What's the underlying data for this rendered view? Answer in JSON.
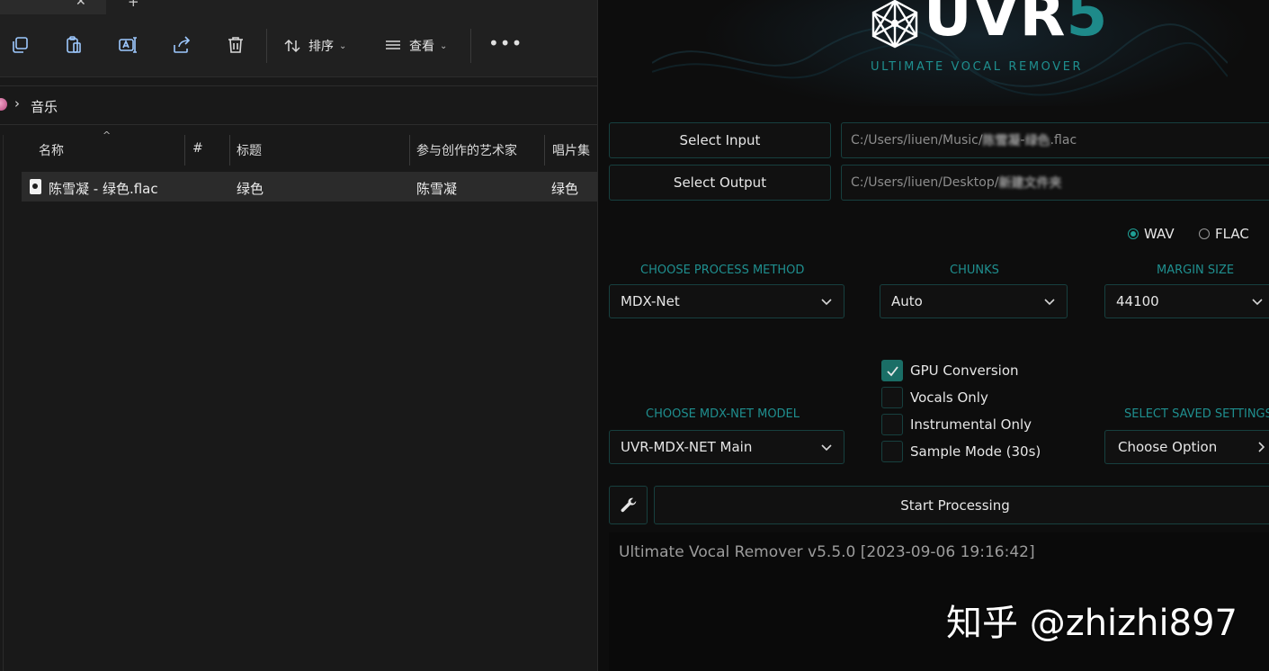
{
  "explorer": {
    "toolbar": {
      "sort_label": "排序",
      "view_label": "查看",
      "more_label": "•••"
    },
    "address": {
      "folder": "音乐"
    },
    "columns": {
      "name": "名称",
      "number": "#",
      "title": "标题",
      "artist": "参与创作的艺术家",
      "album": "唱片集"
    },
    "files": [
      {
        "name": "陈雪凝 - 绿色.flac",
        "title": "绿色",
        "artist": "陈雪凝",
        "album": "绿色"
      }
    ]
  },
  "uvr": {
    "logo": {
      "word": "UVR",
      "number": "5",
      "tagline": "ULTIMATE VOCAL REMOVER"
    },
    "select_input_label": "Select Input",
    "select_output_label": "Select Output",
    "input_path_prefix": "C:/Users/liuen/Music/",
    "input_path_blurred": "陈雪凝",
    "input_path_mid": " - ",
    "input_path_blurred2": "绿色",
    "input_path_suffix": ".flac",
    "output_path_prefix": "C:/Users/liuen/Desktop/",
    "output_path_blurred": "新建文件夹",
    "format_options": [
      {
        "label": "WAV",
        "selected": true
      },
      {
        "label": "FLAC",
        "selected": false
      }
    ],
    "process_method": {
      "label": "CHOOSE PROCESS METHOD",
      "value": "MDX-Net"
    },
    "chunks": {
      "label": "CHUNKS",
      "value": "Auto"
    },
    "margin": {
      "label": "MARGIN SIZE",
      "value": "44100"
    },
    "model": {
      "label": "CHOOSE MDX-NET MODEL",
      "value": "UVR-MDX-NET Main"
    },
    "saved_settings": {
      "label": "SELECT SAVED SETTINGS",
      "value": "Choose Option"
    },
    "checks": [
      {
        "label": "GPU Conversion",
        "checked": true
      },
      {
        "label": "Vocals Only",
        "checked": false
      },
      {
        "label": "Instrumental Only",
        "checked": false
      },
      {
        "label": "Sample Mode (30s)",
        "checked": false
      }
    ],
    "start_label": "Start Processing",
    "console_text": "Ultimate Vocal Remover v5.5.0 [2023-09-06 19:16:42]",
    "accent_color": "#1f8f8f"
  },
  "watermark": "知乎 @zhizhi897"
}
